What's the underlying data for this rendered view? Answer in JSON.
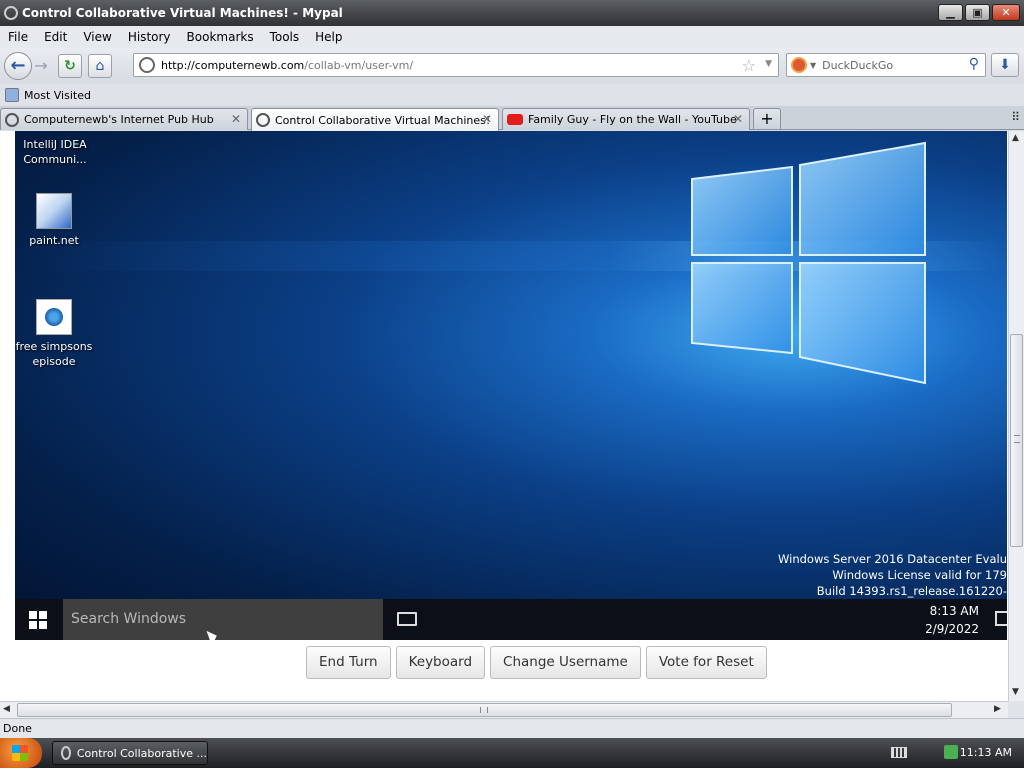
{
  "window": {
    "title": "Control Collaborative Virtual Machines! - Mypal",
    "buttons": {
      "minimize": "▁",
      "maximize": "▣",
      "close": "✕"
    }
  },
  "menu": [
    "File",
    "Edit",
    "View",
    "History",
    "Bookmarks",
    "Tools",
    "Help"
  ],
  "nav": {
    "url_host": "http://computernewb.com",
    "url_path": "/collab-vm/user-vm/",
    "search_placeholder": "DuckDuckGo"
  },
  "bookmarks": {
    "most_visited": "Most Visited"
  },
  "tabs": [
    {
      "label": "Computernewb's Internet Pub Hub",
      "active": false
    },
    {
      "label": "Control Collaborative Virtual Machines!",
      "active": true
    },
    {
      "label": "Family Guy - Fly on the Wall - YouTube",
      "active": false
    }
  ],
  "vm": {
    "desktop_icons": [
      {
        "label": "IntelliJ IDEA Communi..."
      },
      {
        "label": "paint.net"
      },
      {
        "label": "free simpsons episode"
      }
    ],
    "watermark": [
      "Windows Server 2016 Datacenter Evalu",
      "Windows License valid for 179",
      "Build 14393.rs1_release.161220-"
    ],
    "search_placeholder": "Search Windows",
    "clock_time": "8:13 AM",
    "clock_date": "2/9/2022",
    "colors": {
      "taskbar": "#0a0f18",
      "search": "#3f3f3f"
    }
  },
  "vm_buttons": [
    "End Turn",
    "Keyboard",
    "Change Username",
    "Vote for Reset"
  ],
  "status": "Done",
  "os_taskbar": {
    "task_label": "Control Collaborative ...",
    "clock": "11:13 AM"
  }
}
